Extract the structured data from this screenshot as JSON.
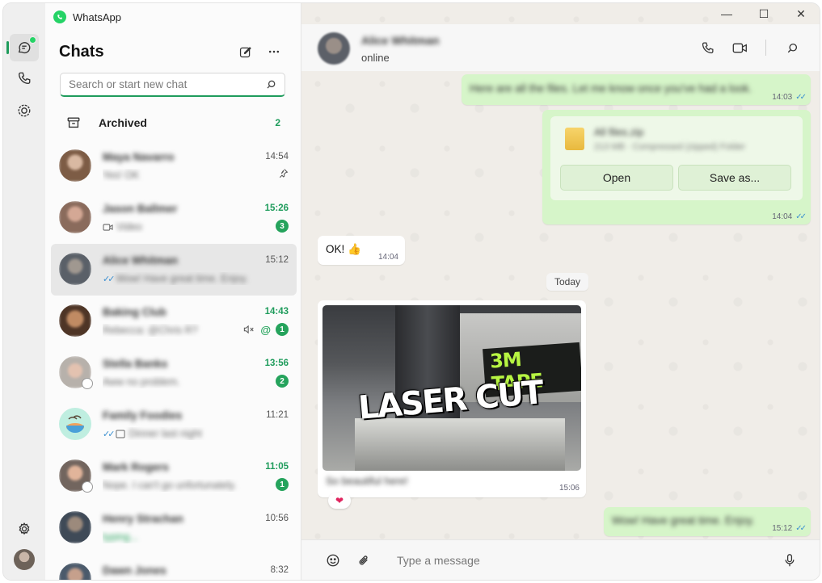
{
  "app": {
    "title": "WhatsApp"
  },
  "window_controls": {
    "minimize": "—",
    "maximize": "☐",
    "close": "✕"
  },
  "rail": {
    "items": [
      {
        "icon": "chats-icon"
      },
      {
        "icon": "calls-icon"
      },
      {
        "icon": "status-icon"
      }
    ],
    "settings_icon": "gear-icon"
  },
  "sidebar": {
    "title": "Chats",
    "search_placeholder": "Search or start new chat",
    "archived": {
      "label": "Archived",
      "count": "2"
    },
    "chats": [
      {
        "name": "Maya Navarro",
        "preview": "Yes! OK",
        "time": "14:54",
        "unread": "",
        "pinned": true
      },
      {
        "name": "Jason Ballmer",
        "preview": "Video",
        "time": "15:26",
        "unread": "3",
        "video": true
      },
      {
        "name": "Alice Whitman",
        "preview": "Wow! Have great time. Enjoy.",
        "time": "15:12",
        "unread": "",
        "selected": true,
        "ticks": true
      },
      {
        "name": "Baking Club",
        "preview": "Rebecca: @Chris R?",
        "time": "14:43",
        "unread": "1",
        "muted": true,
        "mention": "@"
      },
      {
        "name": "Stella Banks",
        "preview": "Aww no problem.",
        "time": "13:56",
        "unread": "2"
      },
      {
        "name": "Family Foodies",
        "preview": "Dinner last night",
        "time": "11:21",
        "unread": "",
        "ticks": true
      },
      {
        "name": "Mark Rogers",
        "preview": "Nope. I can't go unfortunately.",
        "time": "11:05",
        "unread": "1"
      },
      {
        "name": "Henry Strachan",
        "preview": "typing...",
        "time": "10:56",
        "unread": "",
        "typing": true
      },
      {
        "name": "Dawn Jones",
        "preview": "",
        "time": "8:32",
        "unread": ""
      }
    ]
  },
  "conversation": {
    "contact_name": "Alice Whitman",
    "contact_status": "online",
    "messages": {
      "m1": {
        "text": "Here are all the files. Let me know once you've had a look.",
        "time": "14:03"
      },
      "file": {
        "name": "All files.zip",
        "meta": "213 MB · Compressed (zipped) Folder",
        "open_label": "Open",
        "save_label": "Save as...",
        "time": "14:04"
      },
      "m3": {
        "text": "OK! 👍",
        "time": "14:04"
      },
      "day": "Today",
      "photo": {
        "sticker_top": "3M TAPE",
        "sticker_main": "LASER CUT",
        "caption": "So beautiful here!",
        "time": "15:06",
        "reaction": "❤"
      },
      "m5": {
        "text": "Wow! Have great time. Enjoy.",
        "time": "15:12"
      }
    },
    "composer_placeholder": "Type a message"
  }
}
